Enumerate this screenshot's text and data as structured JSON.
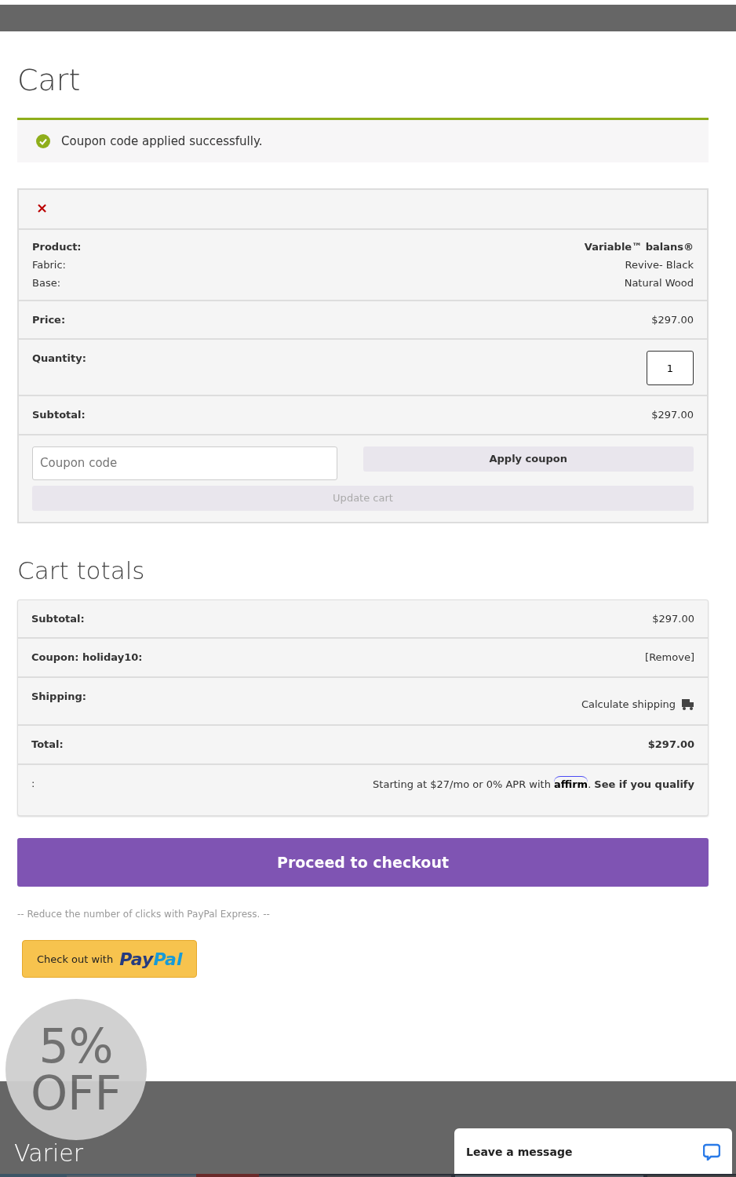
{
  "page_title": "Cart",
  "notice": {
    "kind": "success",
    "text": "Coupon code applied successfully."
  },
  "cart_item": {
    "remove_label": "×",
    "rows": [
      {
        "kind": "details",
        "lines": [
          {
            "label": "Product:",
            "value": "Variable™ balans®",
            "bold": true
          },
          {
            "label": "Fabric:",
            "value": "Revive- Black",
            "bold": false
          },
          {
            "label": "Base:",
            "value": "Natural Wood",
            "bold": false
          }
        ]
      },
      {
        "kind": "text",
        "label": "Price:",
        "value": "$297.00"
      },
      {
        "kind": "quantity",
        "label": "Quantity:",
        "value": "1"
      },
      {
        "kind": "text",
        "label": "Subtotal:",
        "value": "$297.00"
      }
    ],
    "coupon_placeholder": "Coupon code",
    "apply_button": "Apply coupon",
    "update_button": {
      "label": "Update cart",
      "disabled": true
    }
  },
  "totals_title": "Cart totals",
  "totals": [
    {
      "kind": "text",
      "label": "Subtotal:",
      "value": "$297.00",
      "bold": false
    },
    {
      "kind": "link",
      "label": "Coupon: holiday10:",
      "value": "[Remove]",
      "bold": false
    },
    {
      "kind": "shipping",
      "label": "Shipping:",
      "value": "Calculate shipping",
      "bold": false
    },
    {
      "kind": "text",
      "label": "Total:",
      "value": "$297.00",
      "bold": true
    },
    {
      "kind": "affirm",
      "label": ":",
      "value": "Starting at $27/mo or 0% APR with",
      "brand": "affirm",
      "suffix": ".",
      "link": "See if you qualify"
    }
  ],
  "checkout_button": "Proceed to checkout",
  "paypal_note": "-- Reduce the number of clicks with PayPal Express. --",
  "paypal_button": {
    "text": "Check out with",
    "brand_first": "Pay",
    "brand_second": "Pal"
  },
  "promo_badge": {
    "line1": "5%",
    "line2": "OFF"
  },
  "footer": {
    "logo": "Varier"
  },
  "chat": {
    "label": "Leave a message"
  }
}
